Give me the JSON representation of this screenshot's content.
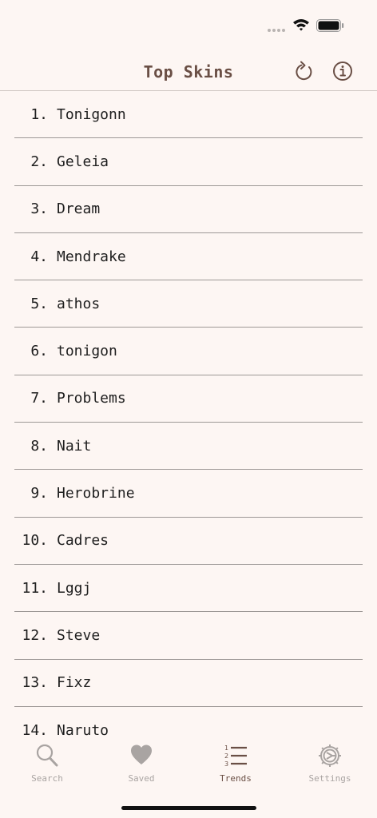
{
  "nav": {
    "title": "Top Skins"
  },
  "skins": [
    {
      "rank": "1.",
      "name": "Tonigonn"
    },
    {
      "rank": "2.",
      "name": "Geleia"
    },
    {
      "rank": "3.",
      "name": "Dream"
    },
    {
      "rank": "4.",
      "name": "Mendrake"
    },
    {
      "rank": "5.",
      "name": "athos"
    },
    {
      "rank": "6.",
      "name": "tonigon"
    },
    {
      "rank": "7.",
      "name": "Problems"
    },
    {
      "rank": "8.",
      "name": "Nait"
    },
    {
      "rank": "9.",
      "name": "Herobrine"
    },
    {
      "rank": "10.",
      "name": "Cadres"
    },
    {
      "rank": "11.",
      "name": "Lggj"
    },
    {
      "rank": "12.",
      "name": "Steve"
    },
    {
      "rank": "13.",
      "name": "Fixz"
    },
    {
      "rank": "14.",
      "name": "Naruto"
    }
  ],
  "tabs": [
    {
      "label": "Search",
      "icon": "search-icon"
    },
    {
      "label": "Saved",
      "icon": "heart-icon"
    },
    {
      "label": "Trends",
      "icon": "ordered-list-icon"
    },
    {
      "label": "Settings",
      "icon": "gear-icon"
    }
  ],
  "active_tab": "Trends",
  "colors": {
    "background": "#fdf6f3",
    "accent": "#6a4f45",
    "inactive": "#a9a4a2"
  }
}
